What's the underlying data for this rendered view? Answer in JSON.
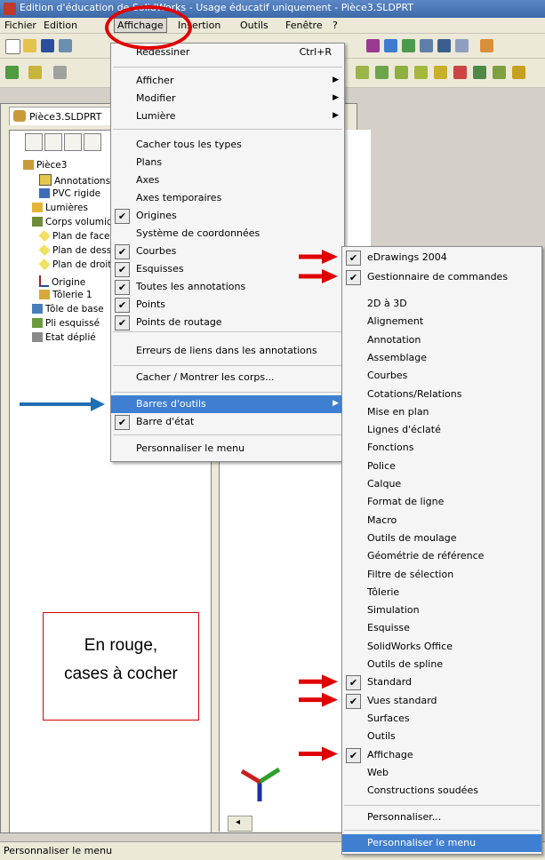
{
  "window": {
    "title": "Edition d'éducation de SolidWorks - Usage éducatif uniquement - Pièce3.SLDPRT"
  },
  "menubar": {
    "items": [
      "Fichier",
      "Edition",
      "Affichage",
      "Insertion",
      "Outils",
      "Fenêtre",
      "?"
    ]
  },
  "document": {
    "tab_label": "Pièce3.SLDPRT",
    "tree": [
      "Pièce3",
      "Annotations",
      "PVC rigide",
      "Lumières",
      "Corps volumiques",
      "Plan de face",
      "Plan de dessus",
      "Plan de droite",
      "Origine",
      "Tôlerie 1",
      "Tôle de base",
      "Pli esquissé",
      "Etat déplié"
    ]
  },
  "view_menu": {
    "redraw": {
      "label": "Redessiner",
      "shortcut": "Ctrl+R"
    },
    "submenus": [
      "Afficher",
      "Modifier",
      "Lumière"
    ],
    "items": [
      {
        "label": "Cacher tous les types",
        "checked": false
      },
      {
        "label": "Plans",
        "checked": false
      },
      {
        "label": "Axes",
        "checked": false
      },
      {
        "label": "Axes temporaires",
        "checked": false
      },
      {
        "label": "Origines",
        "checked": true
      },
      {
        "label": "Système de coordonnées",
        "checked": false
      },
      {
        "label": "Courbes",
        "checked": true
      },
      {
        "label": "Esquisses",
        "checked": true
      },
      {
        "label": "Toutes les annotations",
        "checked": true
      },
      {
        "label": "Points",
        "checked": true
      },
      {
        "label": "Points de routage",
        "checked": true
      }
    ],
    "link_errors": "Erreurs de liens dans les annotations",
    "hide_show_bodies": "Cacher / Montrer les corps...",
    "toolbars": "Barres d'outils",
    "status_bar": "Barre d'état",
    "customize_menu": "Personnaliser le menu"
  },
  "toolbars_menu": {
    "items": [
      {
        "label": "eDrawings 2004",
        "checked": true
      },
      {
        "label": "Gestionnaire de commandes",
        "checked": true
      },
      {
        "label": "2D à 3D",
        "checked": false
      },
      {
        "label": "Alignement",
        "checked": false
      },
      {
        "label": "Annotation",
        "checked": false
      },
      {
        "label": "Assemblage",
        "checked": false
      },
      {
        "label": "Courbes",
        "checked": false
      },
      {
        "label": "Cotations/Relations",
        "checked": false
      },
      {
        "label": "Mise en plan",
        "checked": false
      },
      {
        "label": "Lignes d'éclaté",
        "checked": false
      },
      {
        "label": "Fonctions",
        "checked": false
      },
      {
        "label": "Police",
        "checked": false
      },
      {
        "label": "Calque",
        "checked": false
      },
      {
        "label": "Format de ligne",
        "checked": false
      },
      {
        "label": "Macro",
        "checked": false
      },
      {
        "label": "Outils de moulage",
        "checked": false
      },
      {
        "label": "Géométrie de référence",
        "checked": false
      },
      {
        "label": "Filtre de sélection",
        "checked": false
      },
      {
        "label": "Tôlerie",
        "checked": false
      },
      {
        "label": "Simulation",
        "checked": false
      },
      {
        "label": "Esquisse",
        "checked": false
      },
      {
        "label": "SolidWorks Office",
        "checked": false
      },
      {
        "label": "Outils de spline",
        "checked": false
      },
      {
        "label": "Standard",
        "checked": true
      },
      {
        "label": "Vues standard",
        "checked": true
      },
      {
        "label": "Surfaces",
        "checked": false
      },
      {
        "label": "Outils",
        "checked": false
      },
      {
        "label": "Affichage",
        "checked": true
      },
      {
        "label": "Web",
        "checked": false
      },
      {
        "label": "Constructions soudées",
        "checked": false
      }
    ],
    "customize": "Personnaliser...",
    "customize_menu": "Personnaliser le menu"
  },
  "annotation": {
    "line1": "En rouge,",
    "line2": "cases à cocher"
  },
  "statusbar": {
    "text": "Personnaliser le menu"
  },
  "colors": {
    "highlight": "#3f7fd1",
    "annotation_red": "#e00000",
    "annotation_blue": "#1f6fb5"
  }
}
